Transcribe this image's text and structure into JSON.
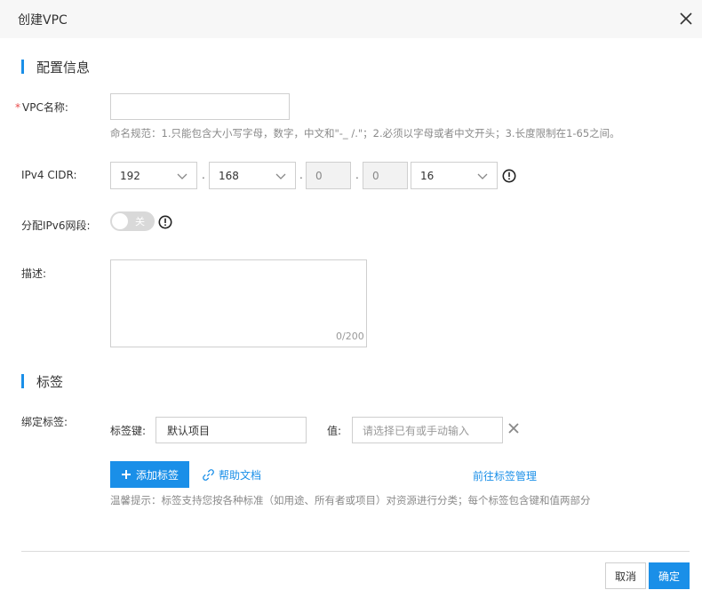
{
  "dialog": {
    "title": "创建VPC"
  },
  "sections": {
    "config": "配置信息",
    "tags": "标签"
  },
  "vpc_name": {
    "required_mark": "*",
    "label": "VPC名称:",
    "value": "",
    "hint": "命名规范：1.只能包含大小写字母，数字，中文和\"-_ /.\"；2.必须以字母或者中文开头；3.长度限制在1-65之间。"
  },
  "cidr": {
    "label": "IPv4 CIDR:",
    "octet1": "192",
    "octet2": "168",
    "octet3": "0",
    "octet4": "0",
    "mask": "16",
    "separator": "."
  },
  "ipv6": {
    "label": "分配IPv6网段:",
    "toggle_text": "关",
    "enabled": false
  },
  "description": {
    "label": "描述:",
    "value": "",
    "counter": "0/200"
  },
  "tags": {
    "label": "绑定标签:",
    "key_label": "标签键:",
    "key_value": "默认项目",
    "value_label": "值:",
    "value_placeholder": "请选择已有或手动输入",
    "add_button": "添加标签",
    "help_link": "帮助文档",
    "manage_link": "前往标签管理",
    "tip": "温馨提示：标签支持您按各种标准（如用途、所有者或项目）对资源进行分类；每个标签包含键和值两部分"
  },
  "footer": {
    "cancel": "取消",
    "confirm": "确定"
  },
  "colors": {
    "accent": "#1a8fe8",
    "required": "#e94b4b",
    "header_bg": "#f7f7f7"
  },
  "icons": [
    "close-icon",
    "chevron-down-icon",
    "warning-circle-icon",
    "plus-icon",
    "link-icon"
  ]
}
